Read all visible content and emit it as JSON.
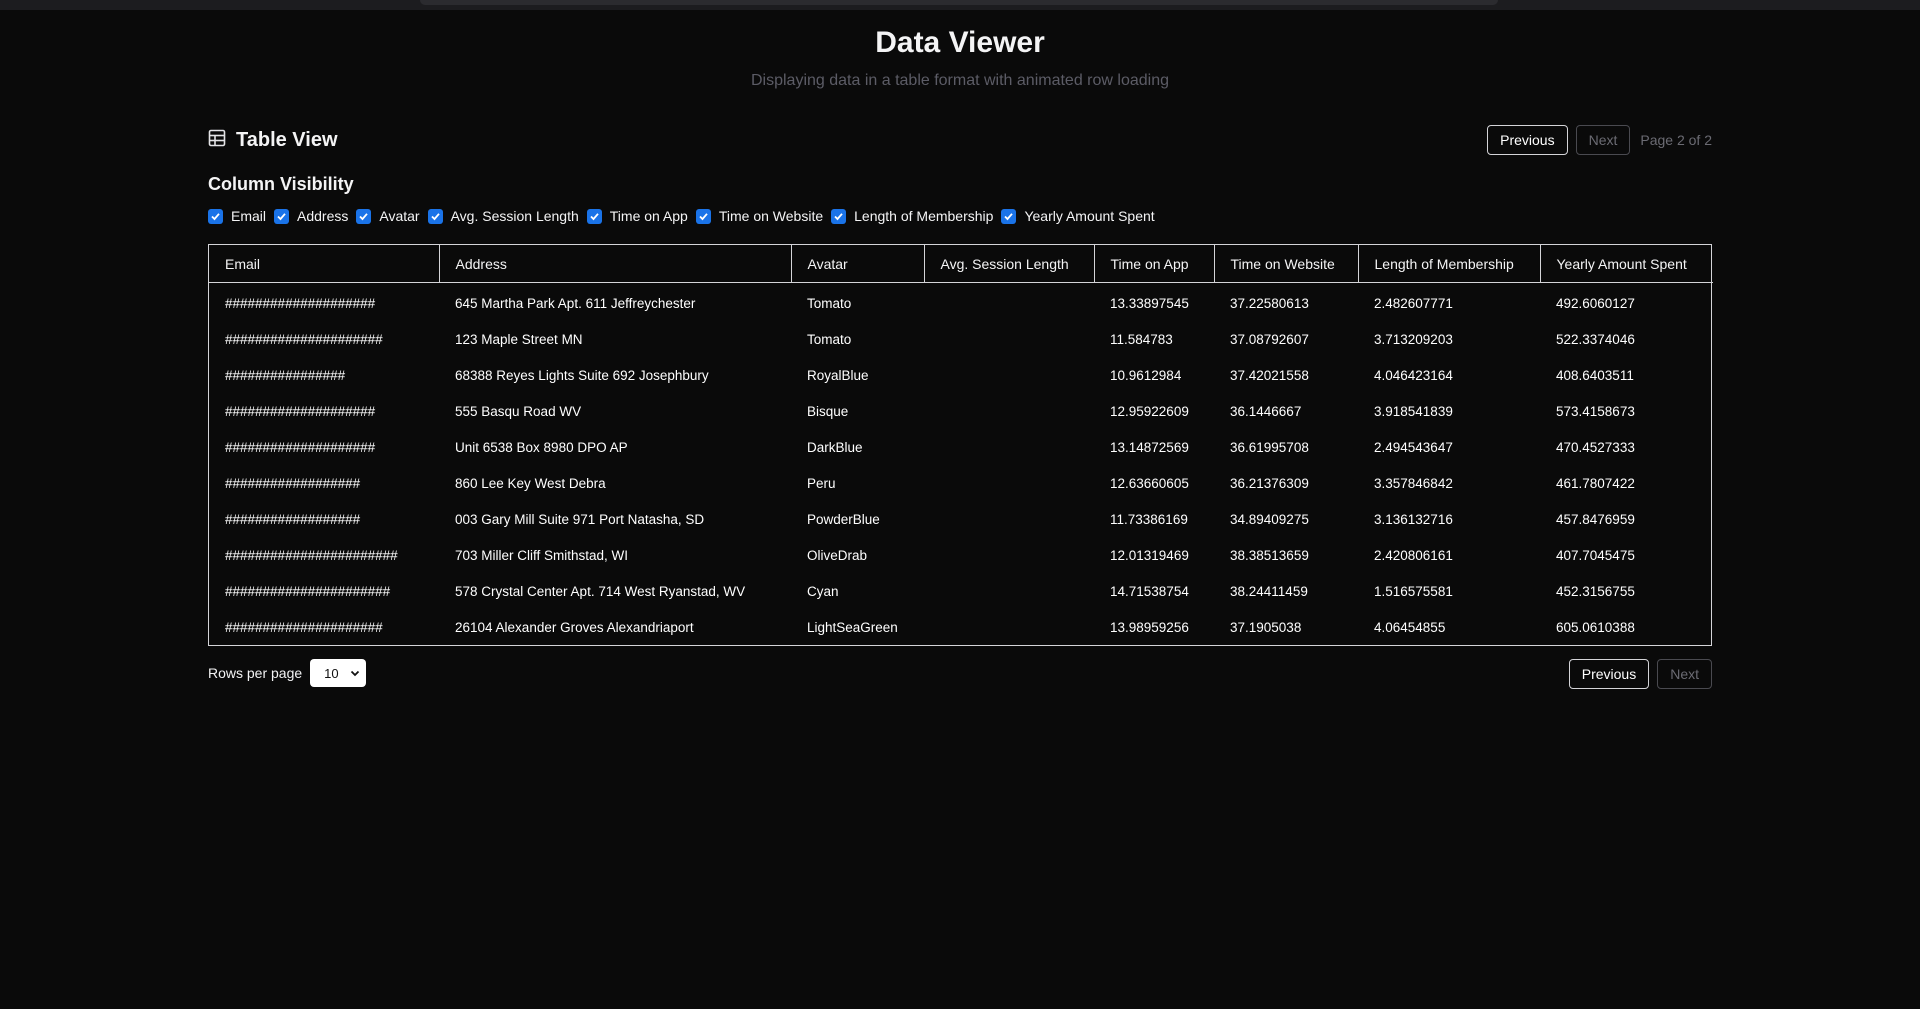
{
  "header": {
    "title": "Data Viewer",
    "subtitle": "Displaying data in a table format with animated row loading"
  },
  "table_view": {
    "title": "Table View",
    "icon": "table-grid-icon",
    "previous_label": "Previous",
    "next_label": "Next",
    "page_info": "Page 2 of 2"
  },
  "column_visibility": {
    "title": "Column Visibility",
    "items": [
      {
        "label": "Email",
        "checked": true
      },
      {
        "label": "Address",
        "checked": true
      },
      {
        "label": "Avatar",
        "checked": true
      },
      {
        "label": "Avg. Session Length",
        "checked": true
      },
      {
        "label": "Time on App",
        "checked": true
      },
      {
        "label": "Time on Website",
        "checked": true
      },
      {
        "label": "Length of Membership",
        "checked": true
      },
      {
        "label": "Yearly Amount Spent",
        "checked": true
      }
    ]
  },
  "table": {
    "columns": [
      "Email",
      "Address",
      "Avatar",
      "Avg. Session Length",
      "Time on App",
      "Time on Website",
      "Length of Membership",
      "Yearly Amount Spent"
    ],
    "rows": [
      [
        "####################",
        "645 Martha Park Apt. 611 Jeffreychester",
        "Tomato",
        "",
        "13.33897545",
        "37.22580613",
        "2.482607771",
        "492.6060127"
      ],
      [
        "#####################",
        "123 Maple Street MN",
        "Tomato",
        "",
        "11.584783",
        "37.08792607",
        "3.713209203",
        "522.3374046"
      ],
      [
        "################",
        "68388 Reyes Lights Suite 692 Josephbury",
        "RoyalBlue",
        "",
        "10.9612984",
        "37.42021558",
        "4.046423164",
        "408.6403511"
      ],
      [
        "####################",
        "555 Basqu Road WV",
        "Bisque",
        "",
        "12.95922609",
        "36.1446667",
        "3.918541839",
        "573.4158673"
      ],
      [
        "####################",
        "Unit 6538 Box 8980 DPO AP",
        "DarkBlue",
        "",
        "13.14872569",
        "36.61995708",
        "2.494543647",
        "470.4527333"
      ],
      [
        "##################",
        "860 Lee Key West Debra",
        "Peru",
        "",
        "12.63660605",
        "36.21376309",
        "3.357846842",
        "461.7807422"
      ],
      [
        "##################",
        "003 Gary Mill Suite 971 Port Natasha, SD",
        "PowderBlue",
        "",
        "11.73386169",
        "34.89409275",
        "3.136132716",
        "457.8476959"
      ],
      [
        "#######################",
        "703 Miller Cliff Smithstad, WI",
        "OliveDrab",
        "",
        "12.01319469",
        "38.38513659",
        "2.420806161",
        "407.7045475"
      ],
      [
        "######################",
        "578 Crystal Center Apt. 714 West Ryanstad, WV",
        "Cyan",
        "",
        "14.71538754",
        "38.24411459",
        "1.516575581",
        "452.3156755"
      ],
      [
        "#####################",
        "26104 Alexander Groves Alexandriaport",
        "LightSeaGreen",
        "",
        "13.98959256",
        "37.1905038",
        "4.06454855",
        "605.0610388"
      ]
    ]
  },
  "footer": {
    "rows_per_page_label": "Rows per page",
    "rows_per_page_value": "10",
    "previous_label": "Previous",
    "next_label": "Next"
  },
  "colors": {
    "background": "#0a0a0a",
    "checkbox_accent": "#1a73e8",
    "border": "#d4d4d8",
    "muted_text": "#6b6b73"
  }
}
